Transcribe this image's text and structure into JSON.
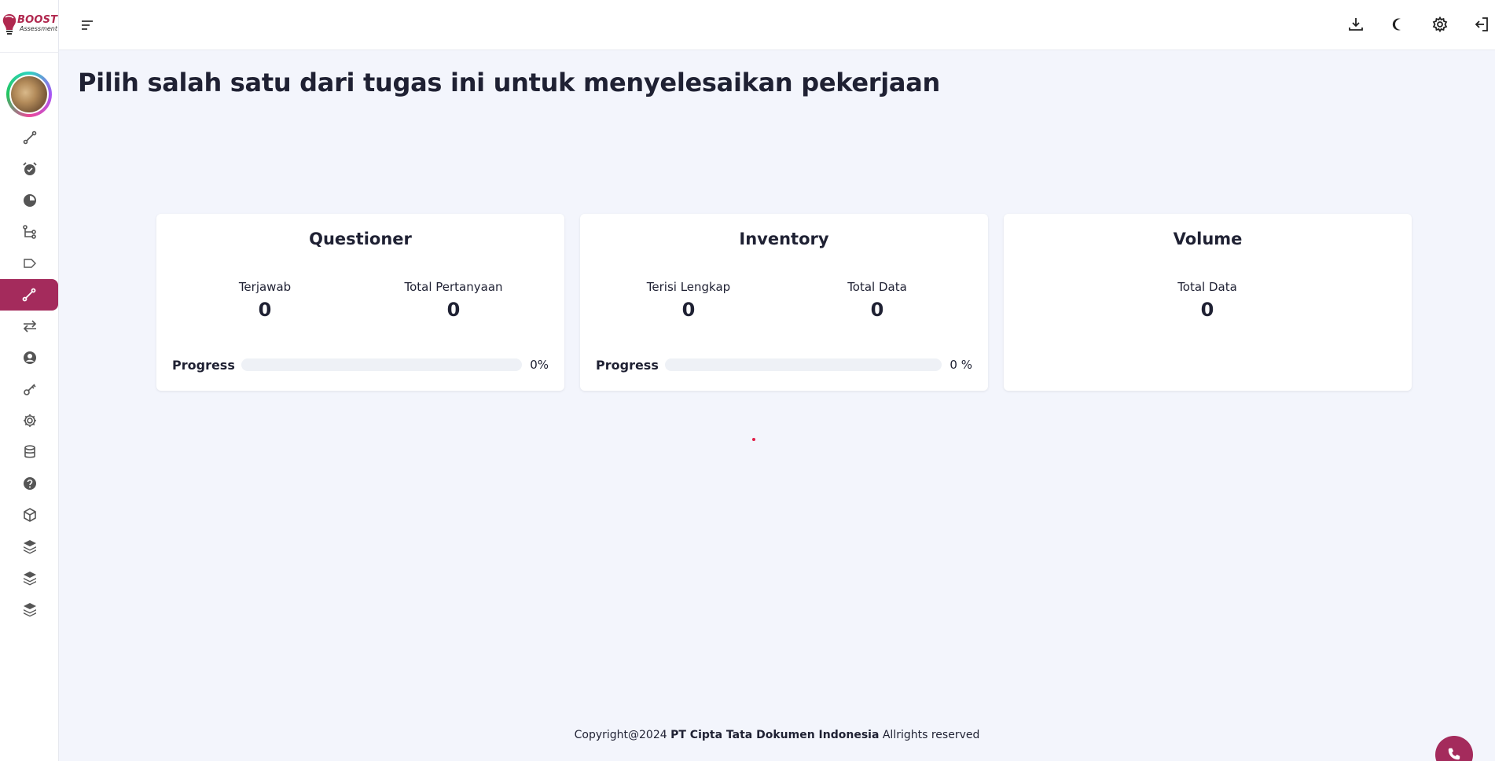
{
  "brand": {
    "name": "BOOST",
    "subtitle": "Assessment"
  },
  "page": {
    "title": "Pilih salah satu dari tugas ini untuk menyelesaikan pekerjaan"
  },
  "sidebar": {
    "items": [
      {
        "icon": "route-icon"
      },
      {
        "icon": "alarm-icon"
      },
      {
        "icon": "pie-icon"
      },
      {
        "icon": "tree-icon"
      },
      {
        "icon": "tag-icon"
      },
      {
        "icon": "route-icon",
        "active": true
      },
      {
        "icon": "transfer-icon"
      },
      {
        "icon": "user-circle-icon"
      },
      {
        "icon": "key-icon"
      },
      {
        "icon": "settings-icon"
      },
      {
        "icon": "database-icon"
      },
      {
        "icon": "help-icon"
      },
      {
        "icon": "box-icon"
      },
      {
        "icon": "layers-icon"
      },
      {
        "icon": "layers-icon"
      },
      {
        "icon": "layers-icon"
      }
    ]
  },
  "topbar": {
    "icons": [
      "menu-icon",
      "download-icon",
      "moon-icon",
      "gear-icon",
      "logout-icon"
    ]
  },
  "cards": {
    "questioner": {
      "title": "Questioner",
      "stat1_label": "Terjawab",
      "stat1_value": "0",
      "stat2_label": "Total Pertanyaan",
      "stat2_value": "0",
      "progress_label": "Progress",
      "progress_text": "0%",
      "progress": 0
    },
    "inventory": {
      "title": "Inventory",
      "stat1_label": "Terisi Lengkap",
      "stat1_value": "0",
      "stat2_label": "Total Data",
      "stat2_value": "0",
      "progress_label": "Progress",
      "progress_text": "0 %",
      "progress": 0
    },
    "volume": {
      "title": "Volume",
      "stat1_label": "Total Data",
      "stat1_value": "0"
    }
  },
  "footer": {
    "prefix": "Copyright@2024 ",
    "company": "PT Cipta Tata Dokumen Indonesia",
    "suffix": " Allrights reserved"
  },
  "colors": {
    "accent": "#a42b5c",
    "background": "#f3f5fc",
    "brand": "#b0284f"
  }
}
